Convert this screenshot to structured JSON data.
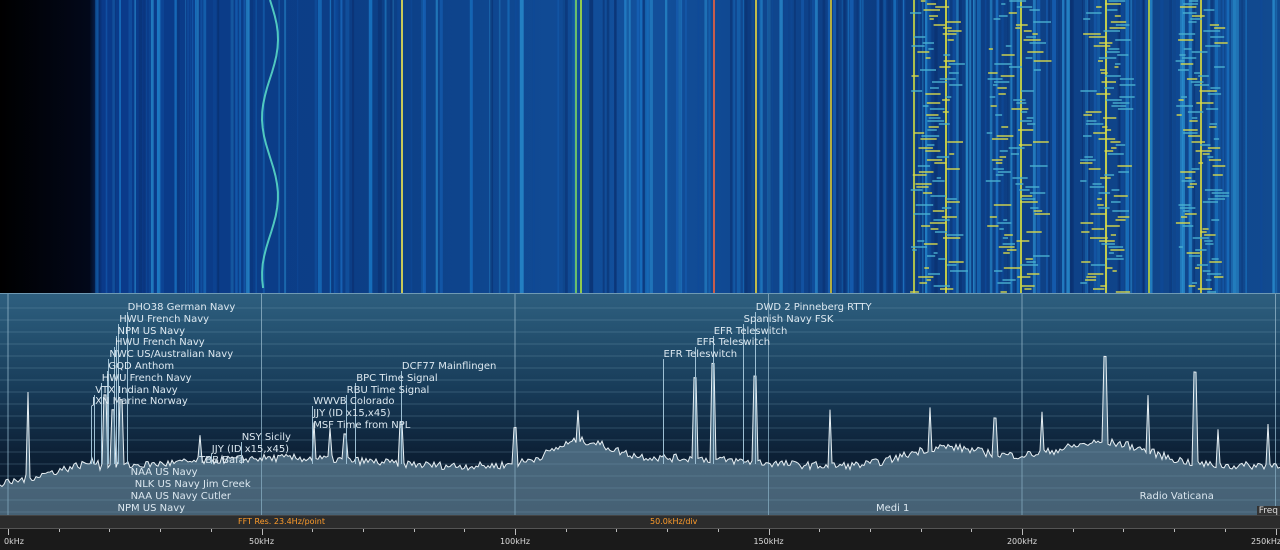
{
  "status": {
    "fft_res": "FFT Res. 23.4Hz/point",
    "div": "50.0kHz/div"
  },
  "axis": {
    "corner_label": "Freq",
    "ticks": [
      {
        "khz": 0,
        "label": "0kHz"
      },
      {
        "khz": 50,
        "label": "50kHz"
      },
      {
        "khz": 100,
        "label": "100kHz"
      },
      {
        "khz": 150,
        "label": "150kHz"
      },
      {
        "khz": 200,
        "label": "200kHz"
      },
      {
        "khz": 250,
        "label": "250kHz"
      }
    ]
  },
  "stations": [
    {
      "name": "DHO38 German Navy",
      "khz": 23.4,
      "level": 0
    },
    {
      "name": "HWU French Navy",
      "khz": 21.75,
      "level": 1
    },
    {
      "name": "NPM US Navy",
      "khz": 21.4,
      "level": 2
    },
    {
      "name": "HWU French Navy",
      "khz": 20.9,
      "level": 3
    },
    {
      "name": "NWC US/Australian Navy",
      "khz": 19.8,
      "level": 4
    },
    {
      "name": "GQD Anthom",
      "khz": 19.6,
      "level": 5
    },
    {
      "name": "HWU French Navy",
      "khz": 18.3,
      "level": 6
    },
    {
      "name": "VTX Indian Navy",
      "khz": 17.0,
      "level": 7
    },
    {
      "name": "JXN Marine Norway",
      "khz": 16.4,
      "level": 8
    },
    {
      "name": "DCF77 Mainflingen",
      "khz": 77.5,
      "level": 5
    },
    {
      "name": "BPC Time Signal",
      "khz": 68.5,
      "level": 6
    },
    {
      "name": "RBU Time Signal",
      "khz": 66.6,
      "level": 7
    },
    {
      "name": "WWVB Colorado",
      "khz": 60.0,
      "level": 8
    },
    {
      "name": "JJY (ID x15,x45)",
      "khz": 60.0,
      "level": 9
    },
    {
      "name": "MSF Time from NPL",
      "khz": 60.0,
      "level": 10
    },
    {
      "name": "NSY Sicily",
      "khz": 45.9,
      "level": 11
    },
    {
      "name": "JJY (ID x15,x45)",
      "khz": 40.0,
      "level": 12
    },
    {
      "name": "TBB Bafa",
      "khz": 37.5,
      "level": 13
    },
    {
      "name": "DWD 2 Pinneberg RTTY",
      "khz": 147.3,
      "level": 0
    },
    {
      "name": "Spanish Navy FSK",
      "khz": 144.9,
      "level": 1
    },
    {
      "name": "EFR Teleswitch",
      "khz": 139.0,
      "level": 2
    },
    {
      "name": "EFR Teleswitch",
      "khz": 135.6,
      "level": 3
    },
    {
      "name": "EFR Teleswitch",
      "khz": 129.1,
      "level": 4
    },
    {
      "name": "NAA US Navy",
      "khz": 24.0,
      "level": 14
    },
    {
      "name": "NLK US Navy Jim Creek",
      "khz": 24.8,
      "level": 15
    },
    {
      "name": "NAA US Navy Cutler",
      "khz": 24.0,
      "level": 16
    },
    {
      "name": "NPM US Navy",
      "khz": 21.4,
      "level": 17
    },
    {
      "name": "Medi 1",
      "khz": 171.0,
      "level": 17
    },
    {
      "name": "Radio Vaticana",
      "khz": 223.0,
      "level": 16
    }
  ],
  "colors": {
    "waterfall_bg": "#061a3a",
    "trace": "#e8f0f4",
    "status_text": "#ff9c2a"
  }
}
